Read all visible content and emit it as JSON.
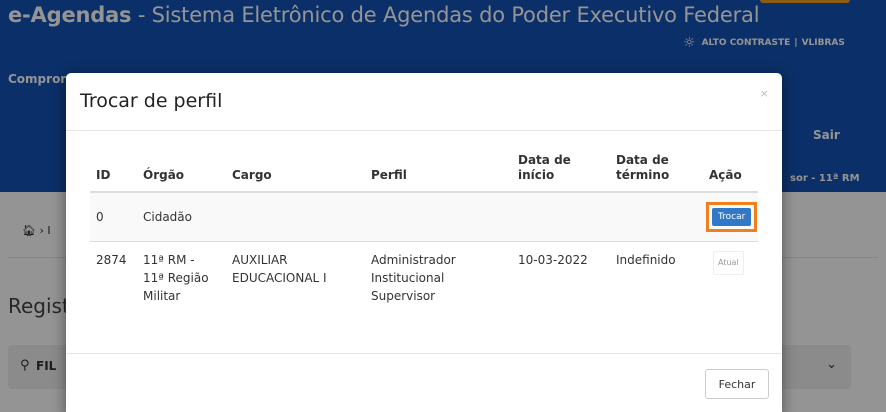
{
  "header": {
    "title_bold": "e-Agendas",
    "title_rest": " - Sistema Eletrônico de Agendas do Poder Executivo Federal",
    "high_contrast": "ALTO CONTRASTE",
    "separator": "|",
    "vlibras": "VLIBRAS",
    "nav_left": "Compror",
    "nav_sair": "Sair",
    "user_info": "sor - 11ª RM",
    "brand_accent": "#f2a21e",
    "header_color": "#1351b4"
  },
  "page": {
    "breadcrumb_home_icon": "home-icon",
    "breadcrumb_chevron": "›",
    "breadcrumb_partial": "I",
    "heading": "Regist",
    "filter_label": "FIL",
    "filter_icon": "search-icon",
    "filter_chevron": "chevron-down-icon"
  },
  "modal": {
    "title": "Trocar de perfil",
    "close": "×",
    "columns": {
      "id": "ID",
      "orgao": "Órgão",
      "cargo": "Cargo",
      "perfil": "Perfil",
      "data_inicio_l1": "Data de",
      "data_inicio_l2": "início",
      "data_termino_l1": "Data de",
      "data_termino_l2": "término",
      "acao": "Ação"
    },
    "rows": [
      {
        "id": "0",
        "orgao": "Cidadão",
        "cargo": "",
        "perfil": "",
        "data_inicio": "",
        "data_termino": "",
        "action_label": "Trocar"
      },
      {
        "id": "2874",
        "orgao_l1": "11ª RM -",
        "orgao_l2": "11ª Região",
        "orgao_l3": "Militar",
        "cargo_l1": "AUXILIAR",
        "cargo_l2": "EDUCACIONAL I",
        "perfil_l1": "Administrador",
        "perfil_l2": "Institucional",
        "perfil_l3": "Supervisor",
        "data_inicio": "10-03-2022",
        "data_termino": "Indefinido",
        "action_label": "Atual"
      }
    ],
    "close_button": "Fechar",
    "highlight_color": "#f07f1f",
    "button_color": "#3178c6"
  }
}
